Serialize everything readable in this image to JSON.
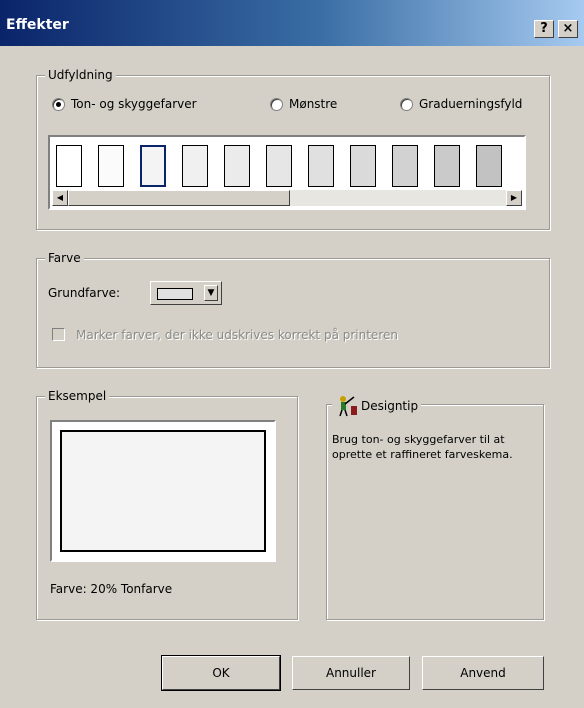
{
  "window": {
    "title": "Effekter",
    "help_button": "?",
    "close_button": "×"
  },
  "fill": {
    "legend": "Udfyldning",
    "options": [
      "Ton- og skyggefarver",
      "Mønstre",
      "Graduerningsfyld"
    ],
    "selected_index": 0,
    "swatches": [
      "#ffffff",
      "#fbfbfb",
      "#f4f4f4",
      "#f0f0f0",
      "#ebebeb",
      "#e6e6e6",
      "#e0e0e0",
      "#dadada",
      "#d2d2d2",
      "#cacaca",
      "#c2c2c2"
    ],
    "selected_swatch": 2
  },
  "color": {
    "legend": "Farve",
    "base_label": "Grundfarve:",
    "base_value_color": "#e0e0e0",
    "checkbox_label": "Marker farver, der ikke udskrives korrekt på printeren"
  },
  "example": {
    "legend": "Eksempel",
    "caption": "Farve: 20% Tonfarve"
  },
  "designtip": {
    "legend": "Designtip",
    "text": "Brug ton- og skyggefarver til at oprette et raffineret farveskema."
  },
  "buttons": {
    "ok": "OK",
    "cancel": "Annuller",
    "apply": "Anvend"
  }
}
